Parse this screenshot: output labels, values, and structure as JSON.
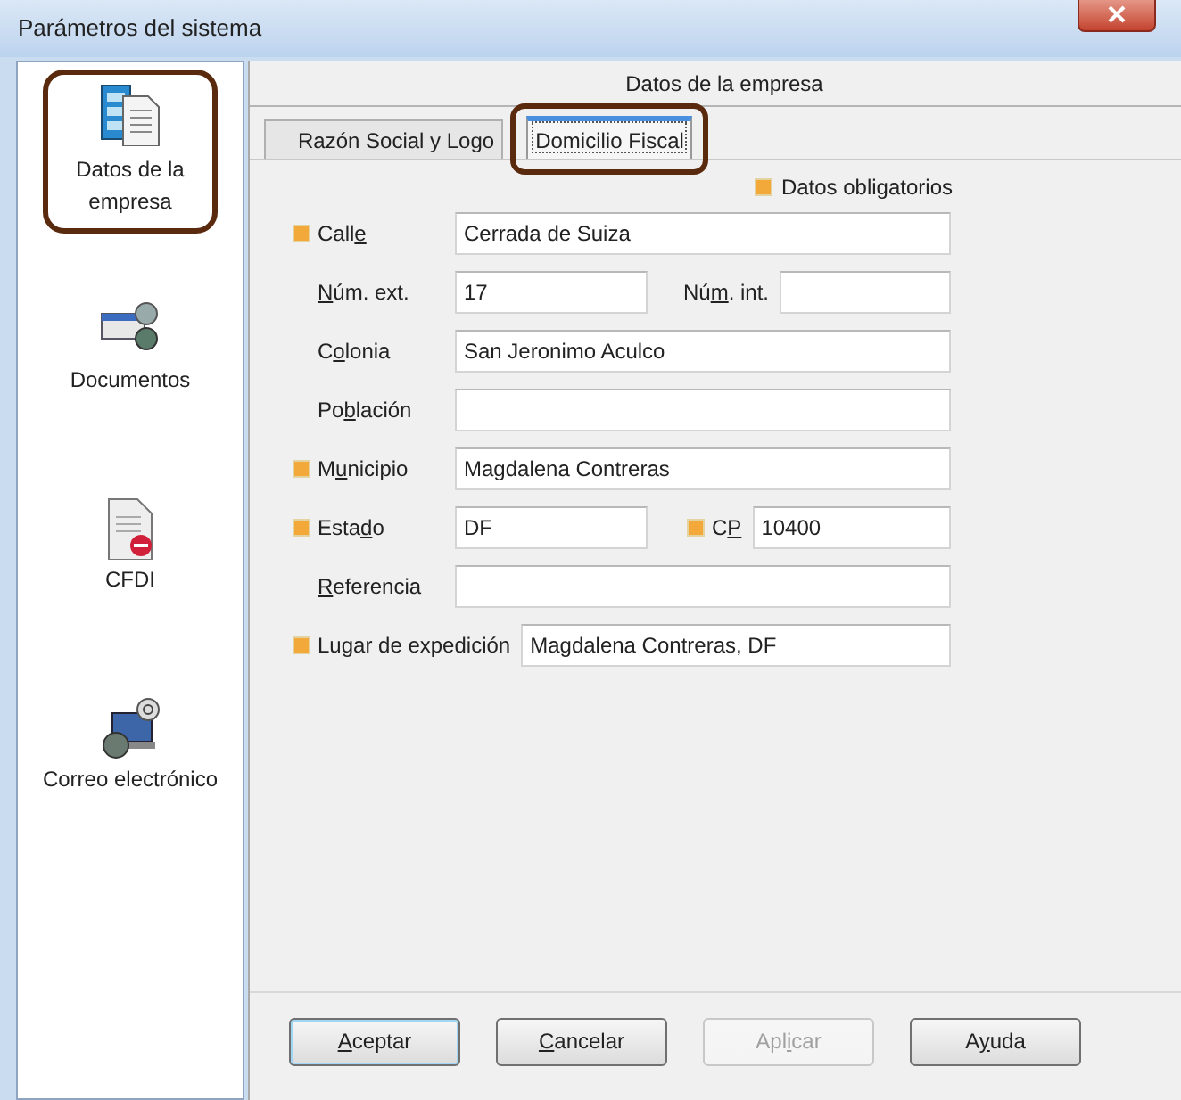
{
  "window": {
    "title": "Parámetros del sistema"
  },
  "sidebar": {
    "items": [
      {
        "label": "Datos de la empresa",
        "kind": "company",
        "highlighted": true
      },
      {
        "label": "Documentos",
        "kind": "documents",
        "highlighted": false
      },
      {
        "label": "CFDI",
        "kind": "cfdi",
        "highlighted": false
      },
      {
        "label": "Correo electrónico",
        "kind": "email",
        "highlighted": false
      }
    ]
  },
  "panel": {
    "title": "Datos de la empresa"
  },
  "tabs": [
    {
      "label": "Razón Social y Logo",
      "selected": false,
      "highlighted": false
    },
    {
      "label": "Domicilio Fiscal",
      "selected": true,
      "highlighted": true
    }
  ],
  "required_legend": "Datos obligatorios",
  "form_rows": [
    {
      "fields": [
        {
          "label": {
            "before": "Call",
            "key": "e"
          },
          "required": true,
          "value": "Cerrada de Suiza"
        }
      ]
    },
    {
      "fields": [
        {
          "label": {
            "key": "N",
            "after": "úm. ext."
          },
          "required": false,
          "value": "17"
        },
        {
          "label": {
            "before": "Nú",
            "key": "m",
            "after": ". int."
          },
          "required": false
        }
      ]
    },
    {
      "fields": [
        {
          "label": {
            "before": "C",
            "key": "o",
            "after": "lonia"
          },
          "required": false,
          "value": "San Jeronimo Aculco"
        }
      ]
    },
    {
      "fields": [
        {
          "label": {
            "before": "Po",
            "key": "b",
            "after": "lación"
          },
          "required": false
        }
      ]
    },
    {
      "fields": [
        {
          "label": {
            "before": "M",
            "key": "u",
            "after": "nicipio"
          },
          "required": true,
          "value": "Magdalena Contreras"
        }
      ]
    },
    {
      "fields": [
        {
          "label": {
            "before": "Esta",
            "key": "d",
            "after": "o"
          },
          "required": true,
          "value": "DF"
        },
        {
          "label": {
            "before": "C",
            "key": "P"
          },
          "required": true,
          "value": "10400"
        }
      ]
    },
    {
      "fields": [
        {
          "label": {
            "key": "R",
            "after": "eferencia"
          },
          "required": false
        }
      ]
    },
    {
      "fields": [
        {
          "label": {
            "before": "Lugar de expedición"
          },
          "required": true,
          "value": "Magdalena Contreras, DF"
        }
      ]
    }
  ],
  "buttons": [
    {
      "label": {
        "key": "A",
        "after": "ceptar"
      },
      "disabled": false,
      "default": true
    },
    {
      "label": {
        "key": "C",
        "after": "ancelar"
      },
      "disabled": false,
      "default": false
    },
    {
      "label": {
        "before": "Apl",
        "key": "i",
        "after": "car"
      },
      "disabled": true,
      "default": false
    },
    {
      "label": {
        "before": "A",
        "key": "y",
        "after": "uda"
      },
      "disabled": false,
      "default": false
    }
  ]
}
